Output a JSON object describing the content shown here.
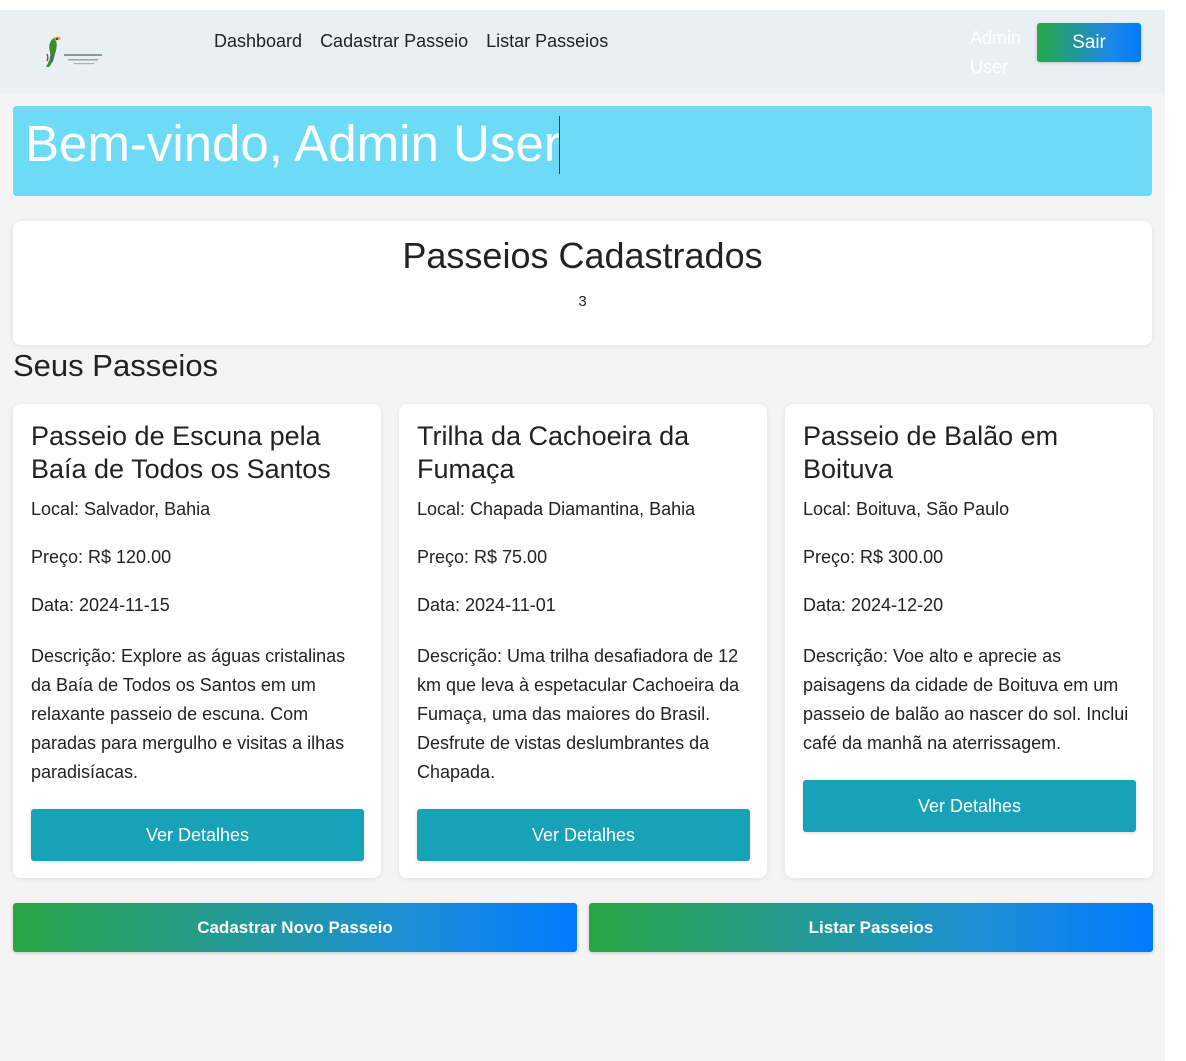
{
  "navbar": {
    "links": [
      "Dashboard",
      "Cadastrar Passeio",
      "Listar Passeios"
    ],
    "user_name": "Admin User",
    "logout_label": "Sair"
  },
  "welcome": {
    "title": "Bem-vindo, Admin User"
  },
  "stats": {
    "title": "Passeios Cadastrados",
    "count": "3"
  },
  "section_title": "Seus Passeios",
  "tours": [
    {
      "title": "Passeio de Escuna pela Baía de Todos os Santos",
      "local": "Local: Salvador, Bahia",
      "preco": "Preço: R$ 120.00",
      "data": "Data: 2024-11-15",
      "descricao": "Descrição: Explore as águas cristalinas da Baía de Todos os Santos em um relaxante passeio de escuna. Com paradas para mergulho e visitas a ilhas paradisíacas.",
      "button_label": "Ver Detalhes"
    },
    {
      "title": "Trilha da Cachoeira da Fumaça",
      "local": "Local: Chapada Diamantina, Bahia",
      "preco": "Preço: R$ 75.00",
      "data": "Data: 2024-11-01",
      "descricao": "Descrição: Uma trilha desafiadora de 12 km que leva à espetacular Cachoeira da Fumaça, uma das maiores do Brasil. Desfrute de vistas deslumbrantes da Chapada.",
      "button_label": "Ver Detalhes"
    },
    {
      "title": "Passeio de Balão em Boituva",
      "local": "Local: Boituva, São Paulo",
      "preco": "Preço: R$ 300.00",
      "data": "Data: 2024-12-20",
      "descricao": "Descrição: Voe alto e aprecie as paisagens da cidade de Boituva em um passeio de balão ao nascer do sol. Inclui café da manhã na aterrissagem.",
      "button_label": "Ver Detalhes"
    }
  ],
  "actions": {
    "new_label": "Cadastrar Novo Passeio",
    "list_label": "Listar Passeios"
  },
  "colors": {
    "banner": "#6ddbf6",
    "details_button": "#17a2b8",
    "gradient_start": "#28a745",
    "gradient_end": "#007bff"
  },
  "icons": {
    "logo": "parrot-logo"
  }
}
